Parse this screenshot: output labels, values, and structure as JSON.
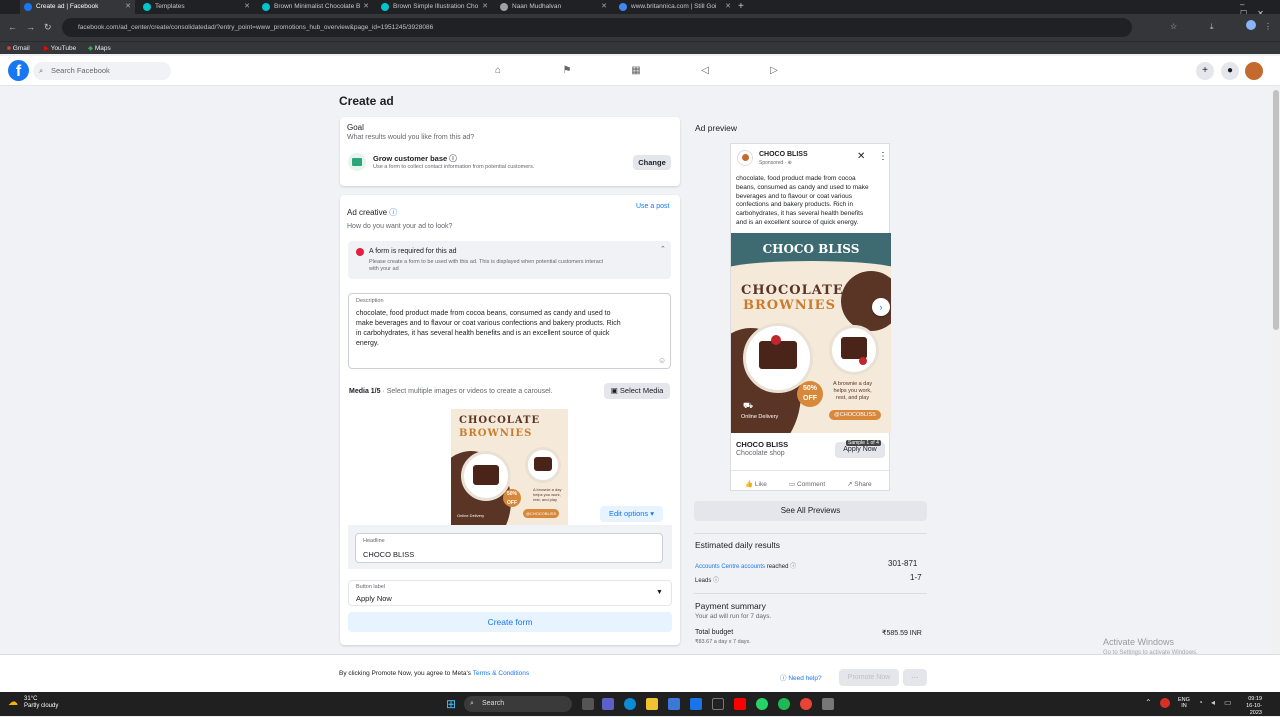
{
  "browser": {
    "tabs": [
      {
        "title": "Create ad | Facebook",
        "active": true
      },
      {
        "title": "Templates",
        "active": false
      },
      {
        "title": "Brown Minimalist Chocolate B",
        "active": false
      },
      {
        "title": "Brown Simple Illustration Cho",
        "active": false
      },
      {
        "title": "Naan Mudhalvan",
        "active": false
      },
      {
        "title": "www.britannica.com | Still Goi",
        "active": false
      }
    ],
    "url": "facebook.com/ad_center/create/consolidatedad/?entry_point=www_promotions_hub_overview&page_id=1951245/3928086",
    "bookmarks": [
      "Gmail",
      "YouTube",
      "Maps"
    ]
  },
  "fb": {
    "search_placeholder": "Search Facebook"
  },
  "page": {
    "title": "Create ad",
    "goal": {
      "heading": "Goal",
      "question": "What results would you like from this ad?",
      "option_title": "Grow customer base",
      "option_desc": "Use a form to collect contact information from potential customers.",
      "change_label": "Change"
    },
    "creative": {
      "heading": "Ad creative",
      "use_post": "Use a post",
      "question": "How do you want your ad to look?",
      "warning_title": "A form is required for this ad",
      "warning_desc_1": "Please create a form to be used with this ad. This is displayed when potential customers interact",
      "warning_desc_2": "with your ad",
      "description_label": "Description",
      "description_lines": [
        "chocolate, food product made from cocoa beans, consumed as candy and used to",
        "make beverages and to flavour or coat various confections and bakery products. Rich",
        "in carbohydrates, it has several health benefits and is an excellent source of quick",
        "energy."
      ],
      "media_label": "Media 1/5",
      "media_hint": "· Select multiple images or videos to create a carousel.",
      "select_media": "Select Media",
      "edit_options": "Edit options",
      "headline_label": "Headline",
      "headline_value": "CHOCO BLISS",
      "button_label_label": "Button label",
      "button_label_value": "Apply Now",
      "create_form": "Create form"
    },
    "footer": {
      "terms_prefix": "By clicking Promote Now, you agree to Meta's",
      "terms_link": "Terms & Conditions",
      "need_help": "Need help?",
      "promote_now": "Promote Now",
      "more": "···"
    }
  },
  "preview": {
    "heading": "Ad preview",
    "page_name": "CHOCO BLISS",
    "sponsored": "Sponsored · ⊕",
    "body_lines": [
      "chocolate, food product made from cocoa",
      "beans, consumed as candy and used to make",
      "beverages and to flavour or coat various",
      "confections and bakery products. Rich in",
      "carbohydrates, it has several health benefits",
      "and is an excellent source of quick energy."
    ],
    "poster_brand": "CHOCO BLISS",
    "poster_title_1": "CHOCOLATE",
    "poster_title_2": "BROWNIES",
    "badge_pct": "50%",
    "badge_off": "OFF",
    "tagline_1": "A brownie a day",
    "tagline_2": "helps you work,",
    "tagline_3": "rest, and play",
    "handle": "@CHOCOBLISS",
    "delivery": "Online Delivery",
    "sample_label": "Sample 1 of 4",
    "headline": "CHOCO BLISS",
    "subline": "Chocolate shop",
    "cta": "Apply Now",
    "like": "Like",
    "comment": "Comment",
    "share": "Share",
    "see_all": "See All Previews"
  },
  "results": {
    "heading": "Estimated daily results",
    "reach_link": "Accounts Centre accounts",
    "reach_suffix": "reached",
    "reach_value": "301-871",
    "leads_label": "Leads",
    "leads_value": "1-7"
  },
  "payment": {
    "heading": "Payment summary",
    "duration": "Your ad will run for 7 days.",
    "total_label": "Total budget",
    "total_value": "₹585.59 INR",
    "per_day": "₹83.67 a day x 7 days."
  },
  "watermark": {
    "line1": "Activate Windows",
    "line2": "Go to Settings to activate Windows."
  },
  "taskbar": {
    "weather_temp": "31°C",
    "weather_desc": "Partly cloudy",
    "search": "Search",
    "lang_1": "ENG",
    "lang_2": "IN",
    "time": "09:19",
    "date": "16-10-2023"
  }
}
